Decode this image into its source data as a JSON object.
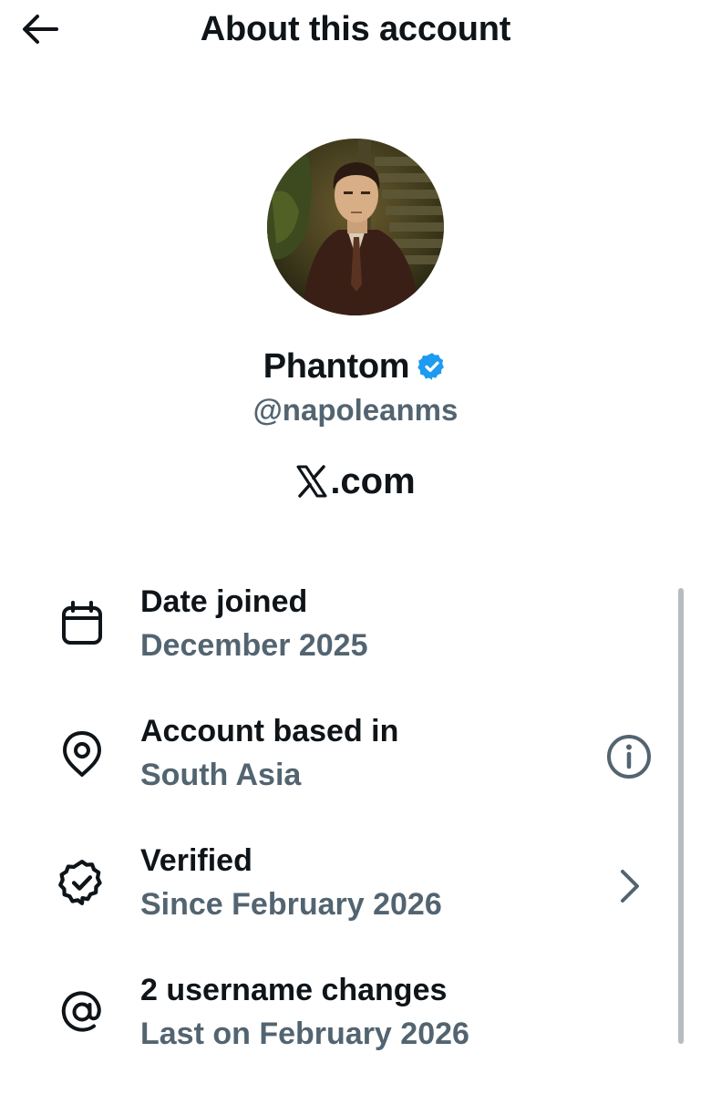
{
  "header": {
    "title": "About this account",
    "back_icon": "arrow-left-icon"
  },
  "profile": {
    "display_name": "Phantom",
    "handle": "@napoleanms",
    "verified_icon": "verified-badge-icon",
    "verified_color": "#1d9bf0",
    "site": ".com",
    "site_logo": "x-logo-icon"
  },
  "details": [
    {
      "icon": "calendar-icon",
      "title": "Date joined",
      "subtitle": "December 2025"
    },
    {
      "icon": "location-pin-icon",
      "title": "Account based in",
      "subtitle": "South Asia",
      "action_icon": "info-icon"
    },
    {
      "icon": "verified-outline-icon",
      "title": "Verified",
      "subtitle": "Since February 2026",
      "action_icon": "chevron-right-icon"
    },
    {
      "icon": "at-sign-icon",
      "title": "2 username changes",
      "subtitle": "Last on February 2026"
    }
  ],
  "colors": {
    "primary_text": "#0f1419",
    "secondary_text": "#536471",
    "background": "#ffffff"
  }
}
